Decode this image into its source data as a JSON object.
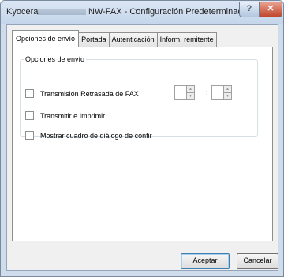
{
  "window": {
    "app_name": "Kyocera",
    "title": "NW-FAX - Configuración Predeterminada",
    "help_label": "?",
    "close_label": "✕"
  },
  "tabs": [
    {
      "label": "Opciones de envío",
      "active": true
    },
    {
      "label": "Portada",
      "active": false
    },
    {
      "label": "Autenticación",
      "active": false
    },
    {
      "label": "Inform. remitente",
      "active": false
    }
  ],
  "send_options": {
    "group_label": "Opciones de envío",
    "delayed_fax": {
      "label": "Transmisión Retrasada de FAX",
      "checked": false
    },
    "send_and_print": {
      "label": "Transmitir e Imprimir",
      "checked": false
    },
    "confirm_dialog": {
      "label": "Mostrar cuadro de diálogo de confir",
      "checked": false
    },
    "time_separator": ":",
    "hour_value": "",
    "minute_value": ""
  },
  "buttons": {
    "accept": "Aceptar",
    "cancel": "Cancelar"
  },
  "icons": {
    "spin_up": "▲",
    "spin_down": "▼"
  }
}
